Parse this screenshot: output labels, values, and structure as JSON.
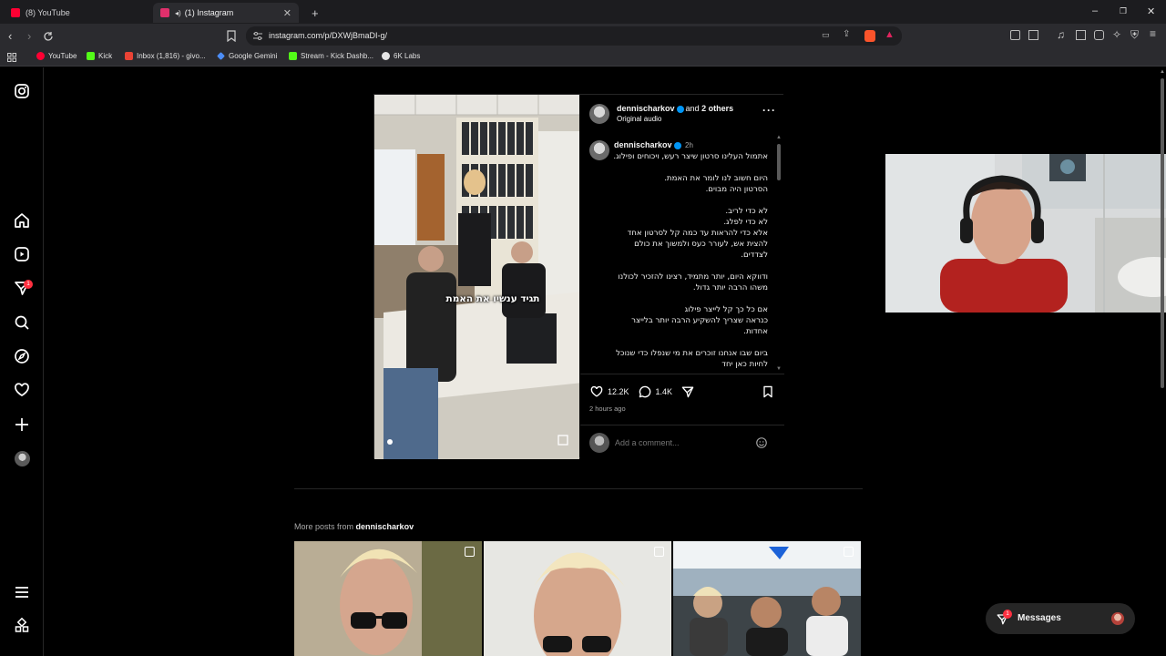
{
  "browser": {
    "tabs": [
      {
        "label": "(8) YouTube",
        "favicon_color": "#ff0033",
        "active": false
      },
      {
        "label": "(1) Instagram",
        "favicon_color": "#e1306c",
        "active": true
      }
    ],
    "new_tab_label": "+",
    "url": "instagram.com/p/DXWjBmaDI-g/",
    "bookmarks": [
      {
        "label": "YouTube",
        "color": "#ff0033"
      },
      {
        "label": "Kick",
        "color": "#53fc18"
      },
      {
        "label": "Inbox (1,816) - givo...",
        "color": "#ea4335"
      },
      {
        "label": "Google Gemini",
        "color": "#4c8df6"
      },
      {
        "label": "Stream - Kick Dashb...",
        "color": "#53fc18"
      },
      {
        "label": "6K Labs",
        "color": "#e6e6e6"
      }
    ]
  },
  "sidebar": {
    "notification_count": "1"
  },
  "post": {
    "header_user": "dennischarkov",
    "header_and": "and",
    "header_others": "2 others",
    "audio": "Original audio",
    "caption_user": "dennischarkov",
    "caption_time": "2h",
    "caption_paragraphs": [
      "אתמול העלינו סרטון שיצר רעש, ויכוחים ופילוג.",
      "היום חשוב לנו לומר את האמת.\nהסרטון היה מבוים.",
      "לא כדי לריב.\nלא כדי לפלג.\nאלא כדי להראות עד כמה קל לסרטון אחד להצית אש, לעורר כעס ולמשוך את כולם לצדדים.",
      "ודווקא היום, יותר מתמיד, רצינו להזכיר לכולנו משהו הרבה יותר גדול.",
      "אם כל כך קל לייצר פילוג\nכנראה שצריך להשקיע הרבה יותר בלייצר אחדות.",
      "ביום שבו אנחנו זוכרים את מי שנפלו כדי שנוכל לחיות כאן יחד"
    ],
    "video_subtitle": "תגיד ענשיו את האמת",
    "likes": "12.2K",
    "comments": "1.4K",
    "posted": "2 hours ago",
    "comment_placeholder": "Add a comment..."
  },
  "more_posts": {
    "prefix": "More posts from",
    "user": "dennischarkov"
  },
  "messages": {
    "label": "Messages",
    "count": "1"
  },
  "colors": {
    "accent": "#0095f6",
    "badge": "#ff3040",
    "background": "#000000"
  }
}
